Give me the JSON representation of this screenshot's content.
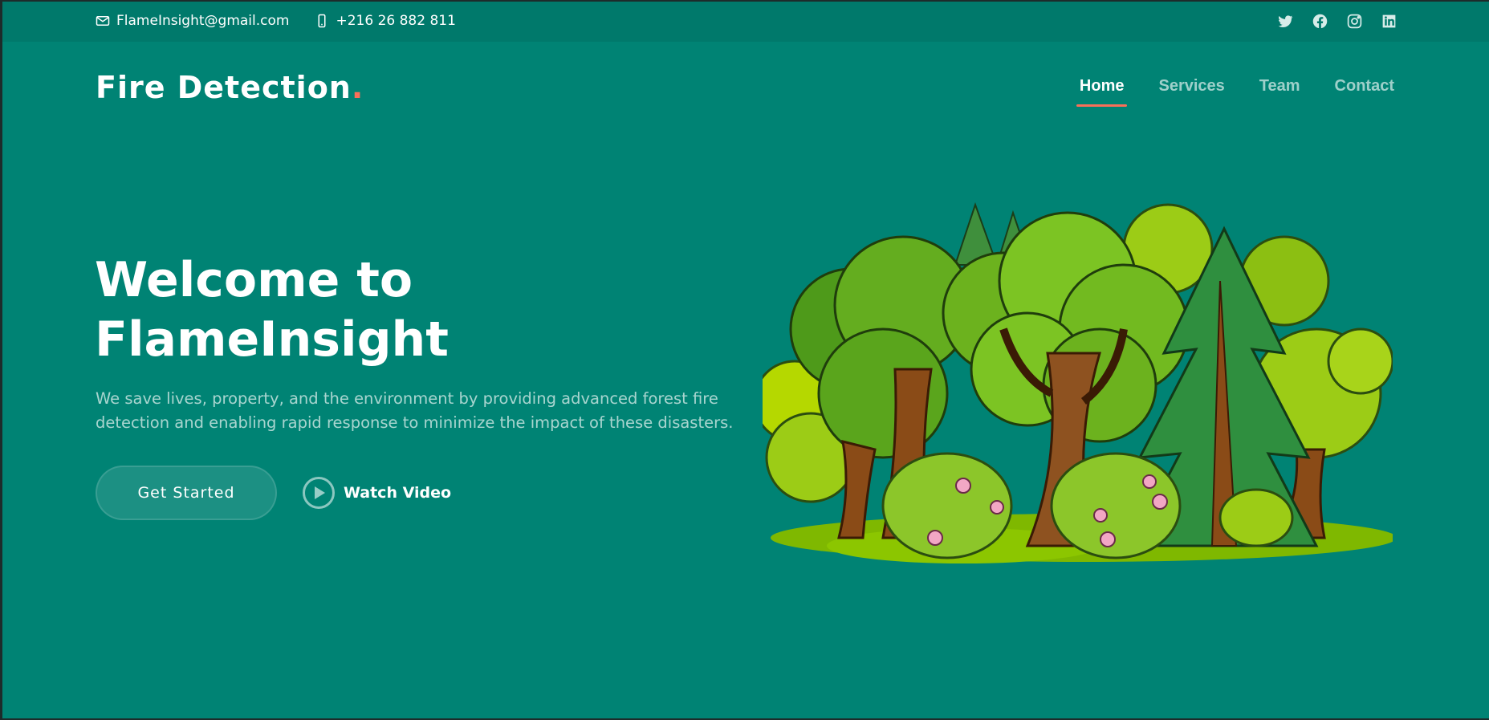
{
  "topbar": {
    "email": "FlameInsight@gmail.com",
    "phone": "+216 26 882 811",
    "social": [
      {
        "name": "twitter-icon"
      },
      {
        "name": "facebook-icon"
      },
      {
        "name": "instagram-icon"
      },
      {
        "name": "linkedin-icon"
      }
    ]
  },
  "header": {
    "logo_text": "Fire Detection",
    "logo_dot": ".",
    "nav": [
      {
        "label": "Home",
        "active": true
      },
      {
        "label": "Services",
        "active": false
      },
      {
        "label": "Team",
        "active": false
      },
      {
        "label": "Contact",
        "active": false
      }
    ]
  },
  "hero": {
    "title_line1": "Welcome to",
    "title_line2": "FlameInsight",
    "description": "We save lives, property, and the environment by providing advanced forest fire detection and enabling rapid response to minimize the impact of these disasters.",
    "cta_label": "Get Started",
    "video_label": "Watch Video"
  },
  "colors": {
    "background": "#008374",
    "topbar": "#00796b",
    "accent": "#f96f59"
  }
}
